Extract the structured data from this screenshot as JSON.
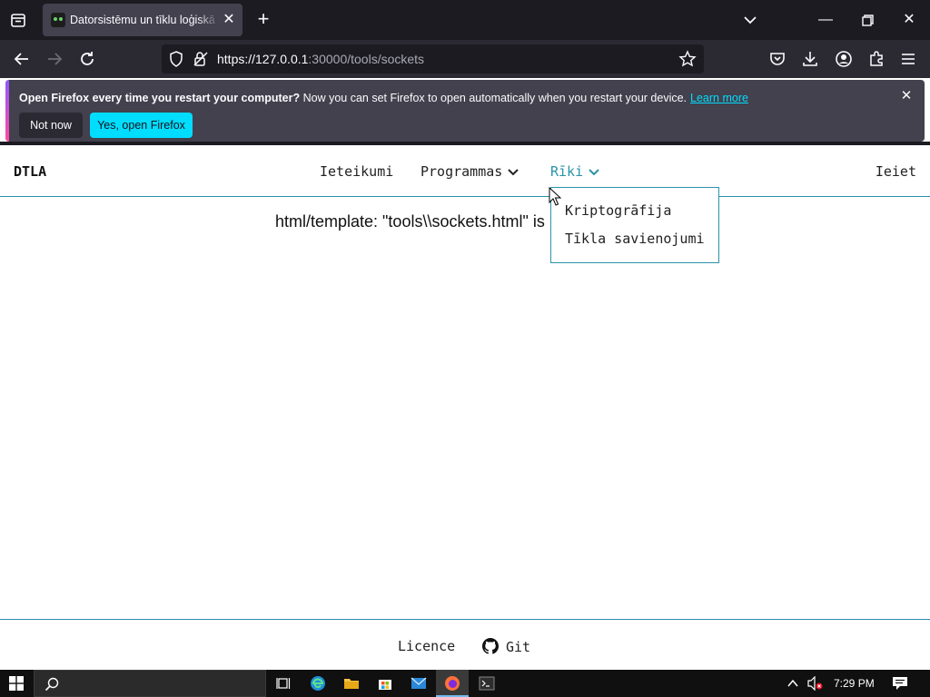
{
  "browser": {
    "tab": {
      "title": "Datorsistēmu un tīklu loģiskā a"
    },
    "url": {
      "host": "https://127.0.0.1",
      "rest": ":30000/tools/sockets"
    },
    "notification": {
      "bold": "Open Firefox every time you restart your computer?",
      "text": " Now you can set Firefox to open automatically when you restart your device.",
      "link": "Learn more",
      "not_now": "Not now",
      "yes": "Yes, open Firefox"
    }
  },
  "site": {
    "brand": "DTLA",
    "nav": {
      "recommendations": "Ieteikumi",
      "programs": "Programmas",
      "tools": "Rīki",
      "login": "Ieiet"
    },
    "dropdown": {
      "items": [
        "Kriptogrāfija",
        "Tīkla savienojumi"
      ]
    },
    "error": "html/template: \"tools\\\\sockets.html\" is undefined",
    "footer": {
      "license": "Licence",
      "git": "Git"
    }
  },
  "taskbar": {
    "time": "7:29 PM"
  },
  "colors": {
    "accent": "#2b93a8",
    "firefox_cta": "#00ddff"
  }
}
